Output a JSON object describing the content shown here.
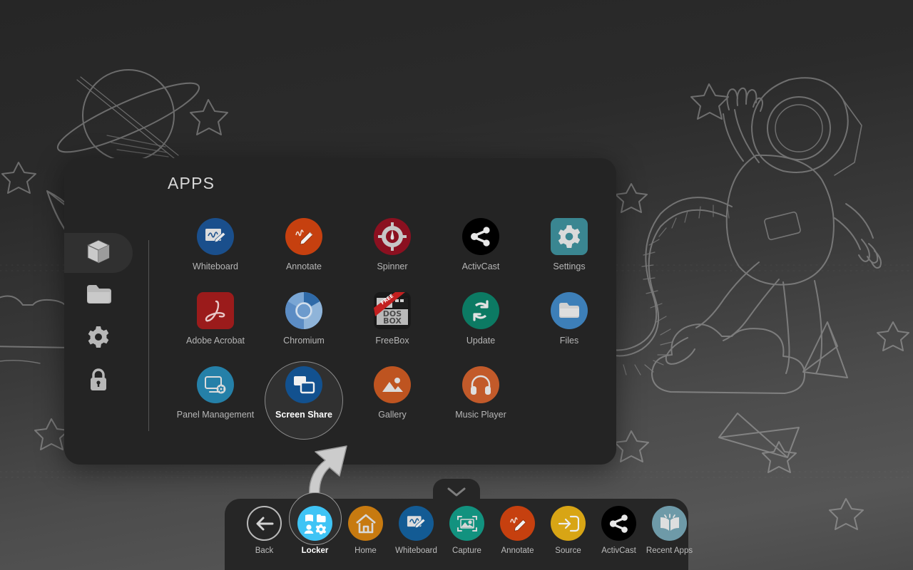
{
  "panel": {
    "title": "APPS",
    "sidebar": [
      {
        "label": "Apps",
        "icon": "cube-icon",
        "active": true
      },
      {
        "label": "Files",
        "icon": "folder-icon",
        "active": false
      },
      {
        "label": "Settings",
        "icon": "gear-icon",
        "active": false
      },
      {
        "label": "Lock",
        "icon": "lock-icon",
        "active": false
      }
    ],
    "apps": [
      {
        "label": "Whiteboard",
        "icon": "whiteboard-icon",
        "color": "#1A4F8C",
        "shape": "circle",
        "selected": false
      },
      {
        "label": "Annotate",
        "icon": "annotate-pen-icon",
        "color": "#C6400F",
        "shape": "circle",
        "selected": false
      },
      {
        "label": "Spinner",
        "icon": "spinner-dial-icon",
        "color": "#8B1020",
        "shape": "circle",
        "selected": false
      },
      {
        "label": "ActivCast",
        "icon": "share-nodes-icon",
        "color": "#000000",
        "shape": "circle",
        "selected": false
      },
      {
        "label": "Settings",
        "icon": "gear-icon",
        "color": "#3A8691",
        "shape": "square",
        "selected": false
      },
      {
        "label": "Adobe Acrobat",
        "icon": "acrobat-icon",
        "color": "#9B1B1B",
        "shape": "square",
        "selected": false
      },
      {
        "label": "Chromium",
        "icon": "chromium-icon",
        "color": "#4C7FBE",
        "shape": "circle",
        "selected": false
      },
      {
        "label": "FreeBox",
        "icon": "dosbox-floppy-icon",
        "color": "#B8B8B8",
        "shape": "square",
        "selected": false
      },
      {
        "label": "Update",
        "icon": "refresh-cycle-icon",
        "color": "#0C7A63",
        "shape": "circle",
        "selected": false
      },
      {
        "label": "Files",
        "icon": "folder-icon",
        "color": "#3D7FB8",
        "shape": "circle",
        "selected": false
      },
      {
        "label": "Panel Management",
        "icon": "panel-settings-icon",
        "color": "#2580A8",
        "shape": "circle",
        "selected": false
      },
      {
        "label": "Screen Share",
        "icon": "screen-share-icon",
        "color": "#12518F",
        "shape": "circle",
        "selected": true
      },
      {
        "label": "Gallery",
        "icon": "image-mountain-icon",
        "color": "#BE5420",
        "shape": "circle",
        "selected": false
      },
      {
        "label": "Music Player",
        "icon": "headphones-icon",
        "color": "#C25A2A",
        "shape": "circle",
        "selected": false
      }
    ]
  },
  "dock": {
    "handle_icon": "chevron-down-icon",
    "items": [
      {
        "label": "Back",
        "icon": "back-arrow-icon",
        "color": "transparent",
        "style": "outline",
        "selected": false
      },
      {
        "label": "Locker",
        "icon": "locker-grid-icon",
        "color": "#3FC4F5",
        "style": "solid",
        "selected": true
      },
      {
        "label": "Home",
        "icon": "home-icon",
        "color": "#C77A10",
        "style": "solid",
        "selected": false
      },
      {
        "label": "Whiteboard",
        "icon": "whiteboard-icon",
        "color": "#135B94",
        "style": "solid",
        "selected": false
      },
      {
        "label": "Capture",
        "icon": "capture-frame-icon",
        "color": "#12927F",
        "style": "solid",
        "selected": false
      },
      {
        "label": "Annotate",
        "icon": "annotate-pen-icon",
        "color": "#C6400F",
        "style": "solid",
        "selected": false
      },
      {
        "label": "Source",
        "icon": "source-input-icon",
        "color": "#D8A515",
        "style": "solid",
        "selected": false
      },
      {
        "label": "ActivCast",
        "icon": "share-nodes-icon",
        "color": "#000000",
        "style": "solid",
        "selected": false
      },
      {
        "label": "Recent Apps",
        "icon": "book-open-icon",
        "color": "#6E9AA8",
        "style": "solid",
        "selected": false
      }
    ]
  },
  "colors": {
    "panel_bg": "#242424",
    "dock_bg": "#262626",
    "selection_ring": "#8a8a8a",
    "label": "#b6b6b6",
    "label_selected": "#ffffff"
  }
}
